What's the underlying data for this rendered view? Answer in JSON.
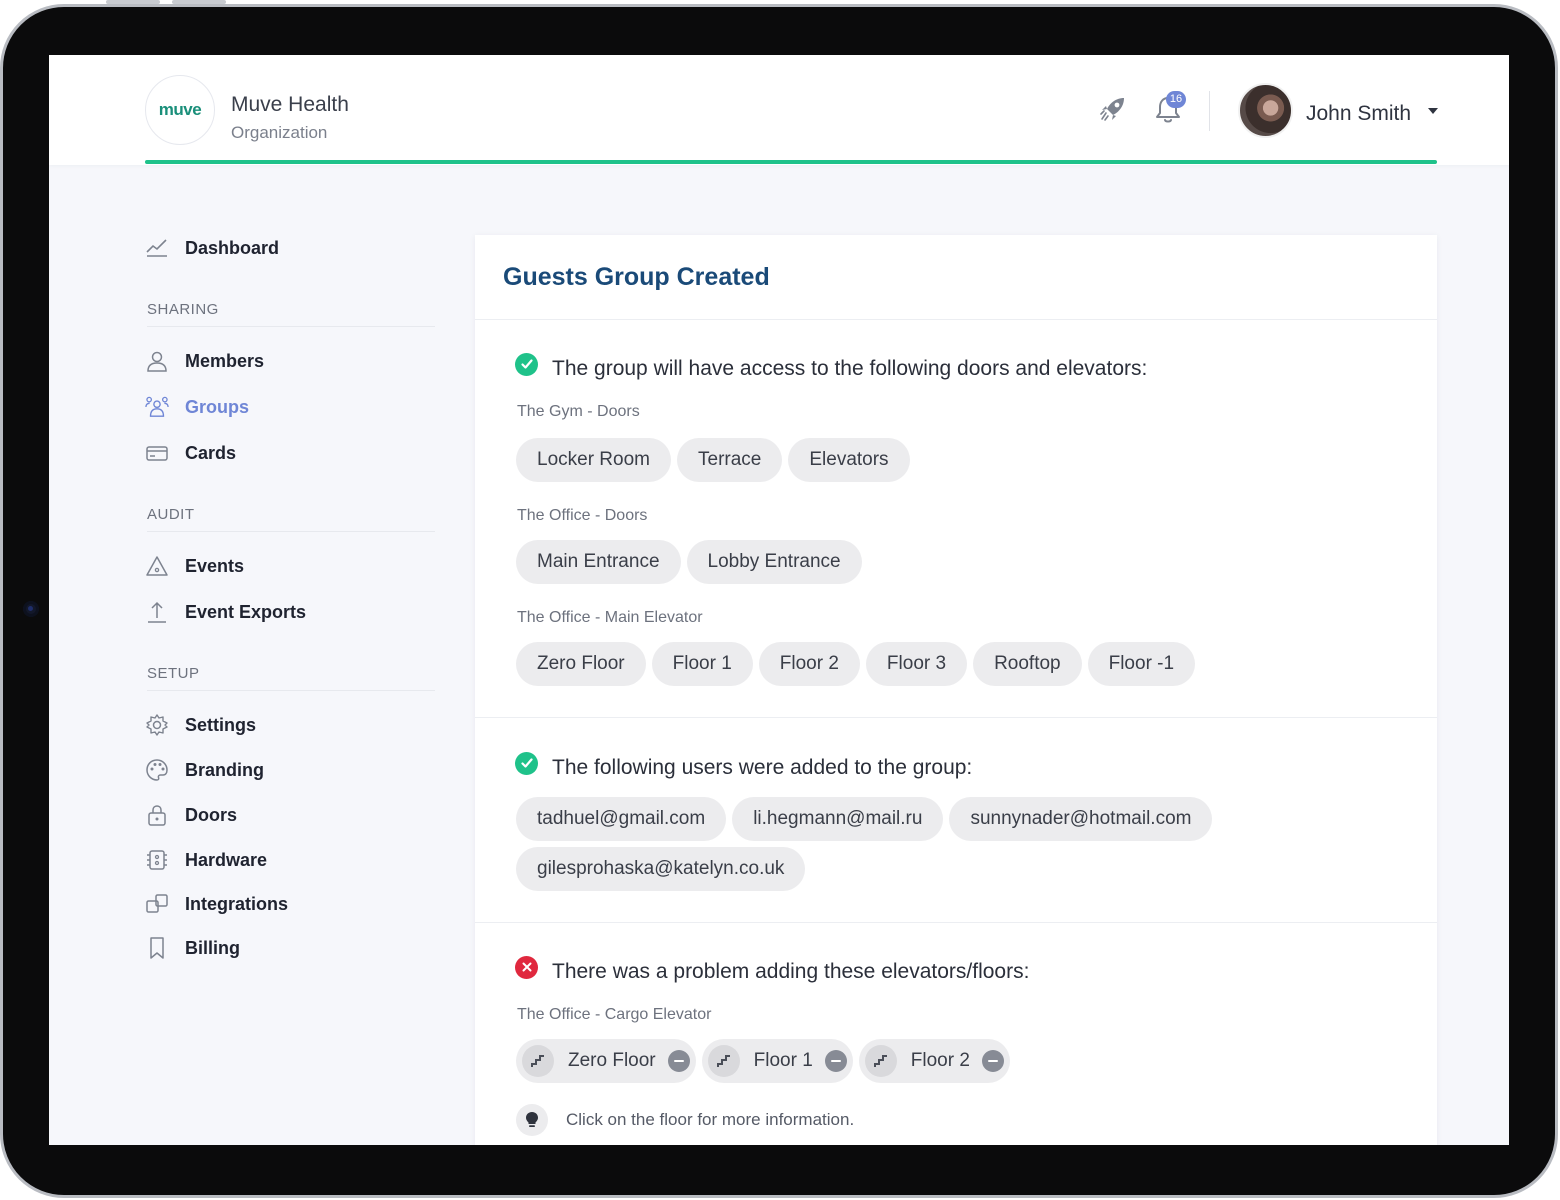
{
  "header": {
    "logo_text": "muve",
    "org_name": "Muve Health",
    "org_type": "Organization",
    "notification_count": "16",
    "user_name": "John Smith",
    "icons": [
      "rocket-icon",
      "bell-icon",
      "caret-down-icon"
    ]
  },
  "sidebar": {
    "dashboard": "Dashboard",
    "sections": [
      {
        "title": "SHARING",
        "items": [
          "Members",
          "Groups",
          "Cards"
        ]
      },
      {
        "title": "AUDIT",
        "items": [
          "Events",
          "Event Exports"
        ]
      },
      {
        "title": "SETUP",
        "items": [
          "Settings",
          "Branding",
          "Doors",
          "Hardware",
          "Integrations",
          "Billing"
        ]
      }
    ],
    "active_item": "Groups"
  },
  "card": {
    "title": "Guests Group Created",
    "access": {
      "heading": "The group will have access to the following doors and elevators:",
      "groups": [
        {
          "label": "The Gym - Doors",
          "chips": [
            "Locker Room",
            "Terrace",
            "Elevators"
          ]
        },
        {
          "label": "The Office - Doors",
          "chips": [
            "Main Entrance",
            "Lobby Entrance"
          ]
        },
        {
          "label": "The Office - Main Elevator",
          "chips": [
            "Zero Floor",
            "Floor 1",
            "Floor 2",
            "Floor 3",
            "Rooftop",
            "Floor -1"
          ]
        }
      ]
    },
    "users": {
      "heading": "The following users were added to the group:",
      "chips": [
        "tadhuel@gmail.com",
        "li.hegmann@mail.ru",
        "sunnynader@hotmail.com",
        "gilesprohaska@katelyn.co.uk"
      ]
    },
    "problem": {
      "heading": "There was a problem adding these elevators/floors:",
      "label": "The Office - Cargo Elevator",
      "chips": [
        "Zero Floor",
        "Floor 1",
        "Floor 2"
      ],
      "hint": "Click on the floor for more information."
    }
  },
  "colors": {
    "accent": "#1fc28a",
    "active_nav": "#6f86d6",
    "title": "#1a4a78",
    "error": "#e0283e"
  }
}
